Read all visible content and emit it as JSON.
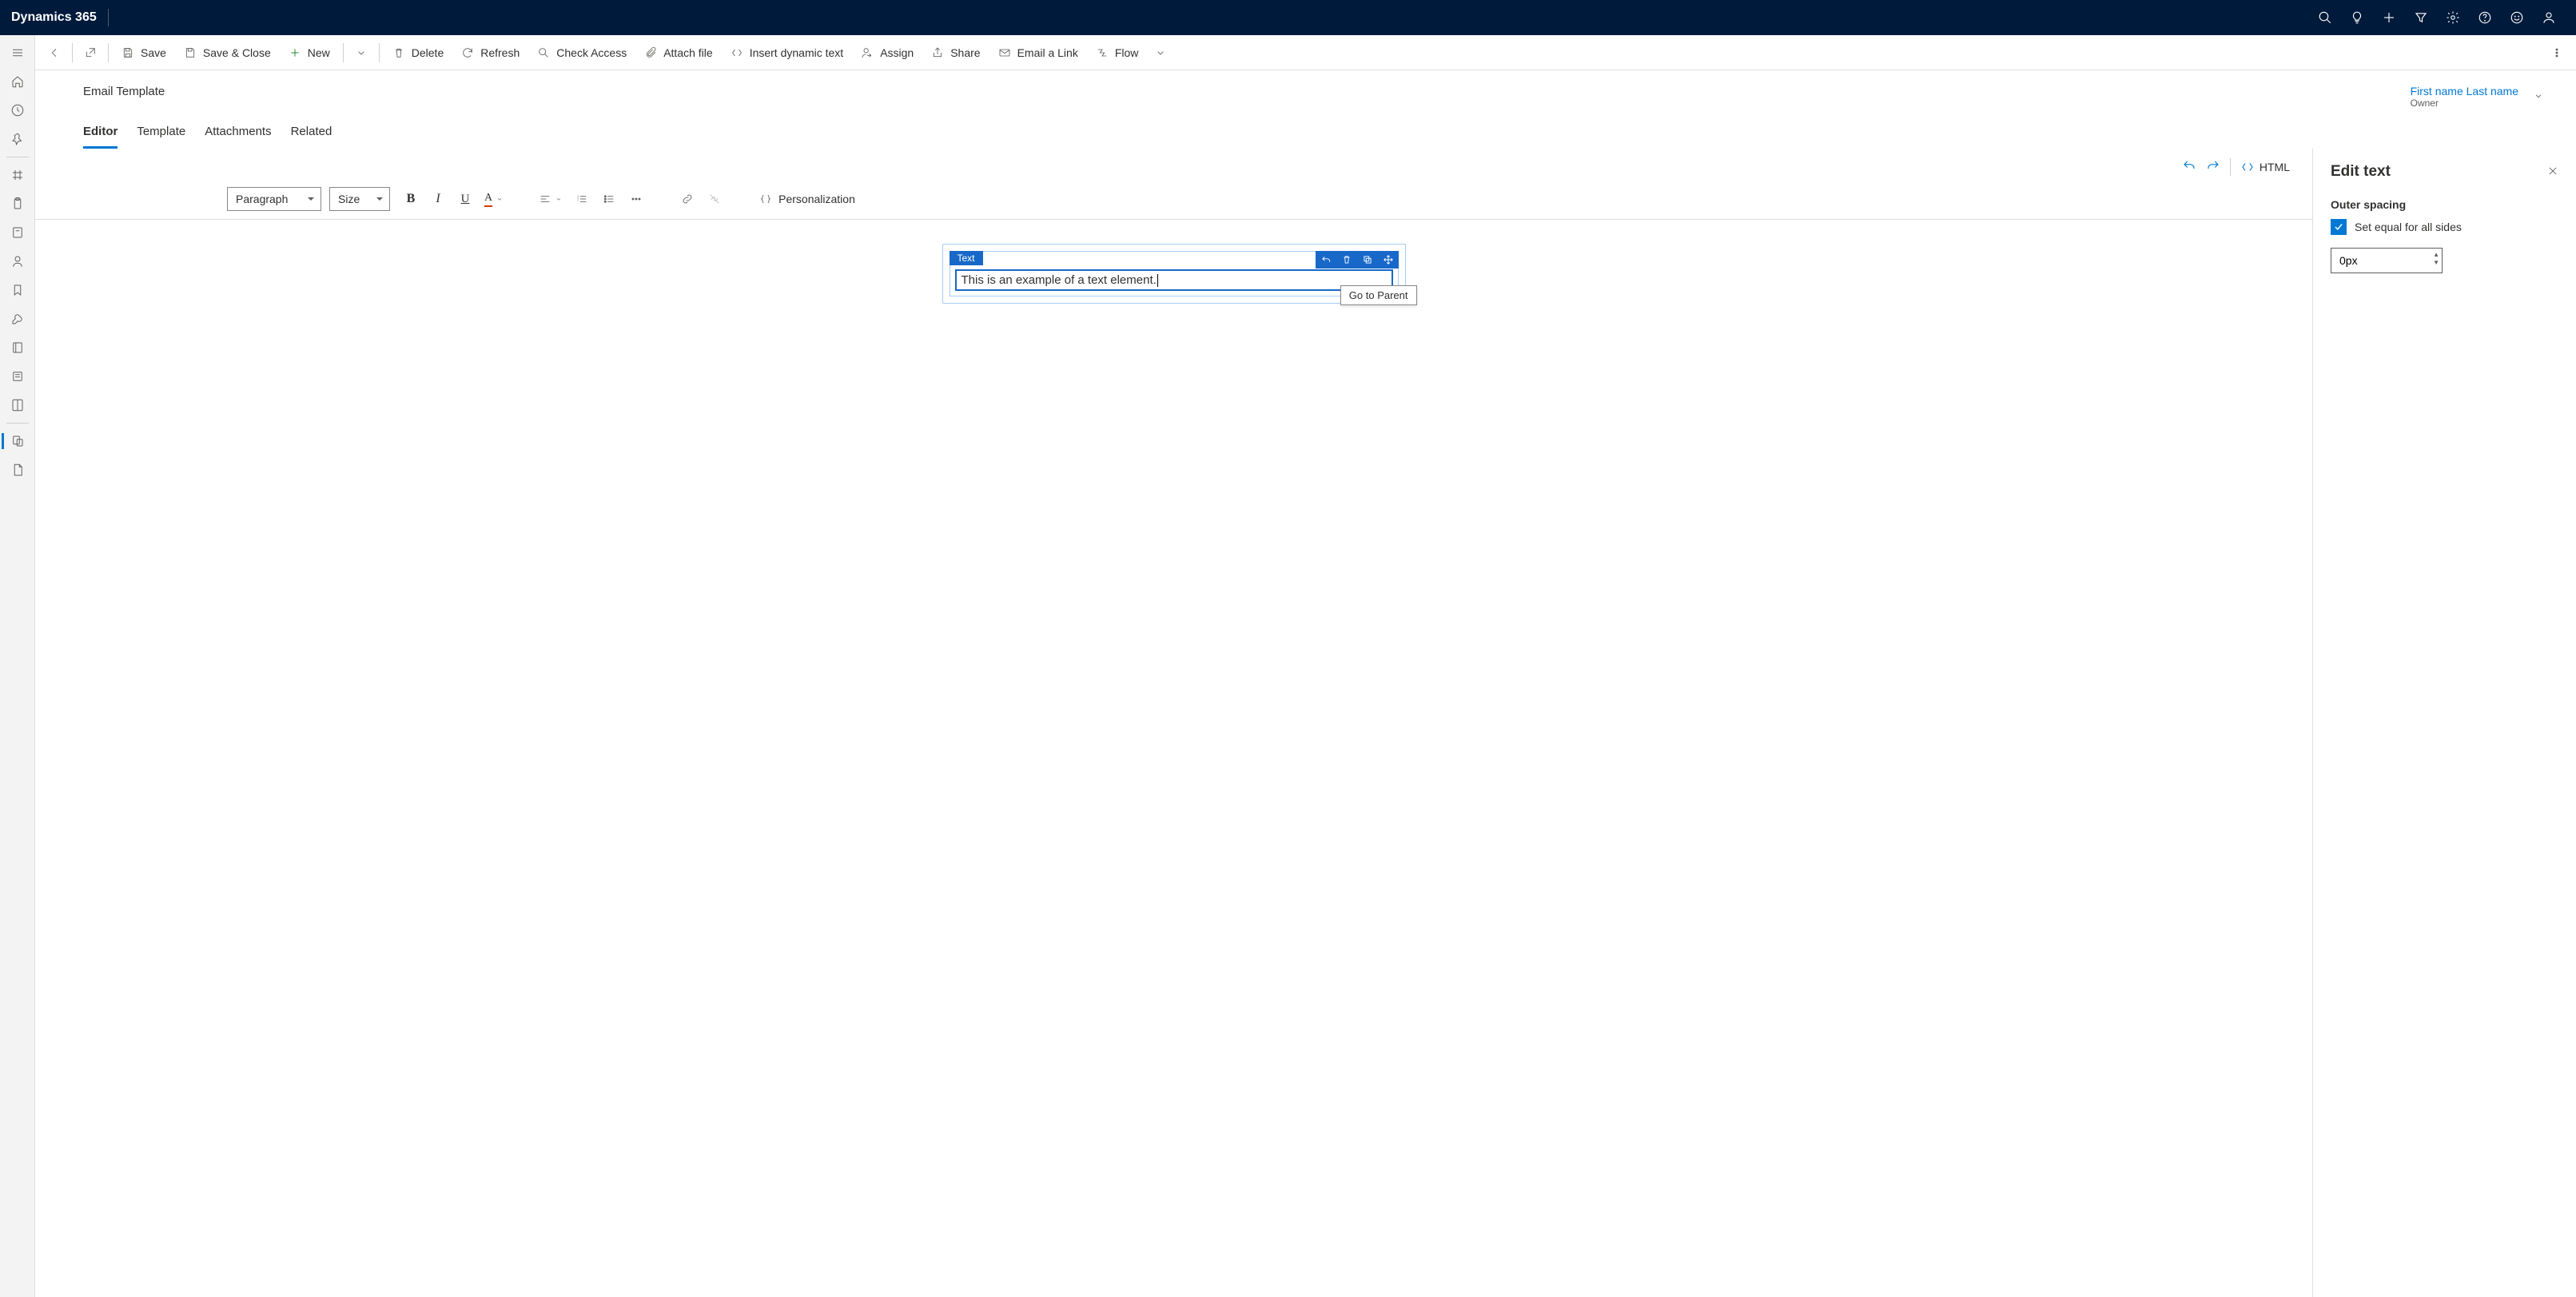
{
  "topbar": {
    "app_name": "Dynamics 365"
  },
  "commandbar": {
    "save": "Save",
    "save_close": "Save & Close",
    "new": "New",
    "delete": "Delete",
    "refresh": "Refresh",
    "check_access": "Check Access",
    "attach_file": "Attach file",
    "insert_dynamic": "Insert dynamic text",
    "assign": "Assign",
    "share": "Share",
    "email_link": "Email a Link",
    "flow": "Flow"
  },
  "record": {
    "title": "Email Template",
    "owner_name": "First name Last name",
    "owner_label": "Owner"
  },
  "tabs": {
    "editor": "Editor",
    "template": "Template",
    "attachments": "Attachments",
    "related": "Related"
  },
  "editor_toolbar": {
    "html": "HTML",
    "paragraph": "Paragraph",
    "size": "Size",
    "personalization": "Personalization"
  },
  "canvas": {
    "chip": "Text",
    "text_content": "This is an example of a text element.",
    "tooltip": "Go to Parent"
  },
  "rightpanel": {
    "title": "Edit text",
    "section": "Outer spacing",
    "checkbox_label": "Set equal for all sides",
    "spacing_value": "0px"
  }
}
